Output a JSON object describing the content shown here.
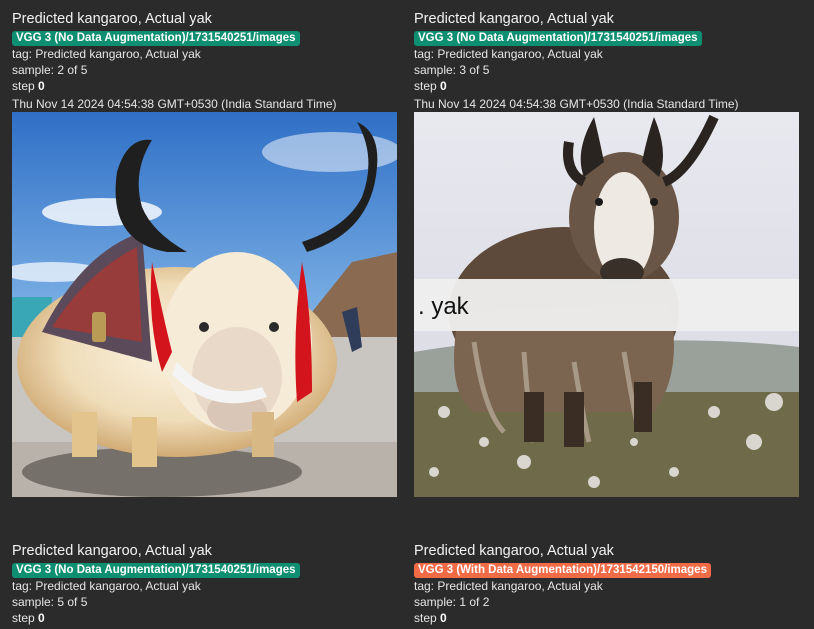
{
  "colors": {
    "badge_no_aug": "#0f8f72",
    "badge_with_aug": "#f26b47",
    "background": "#2b2b2b"
  },
  "cards": [
    {
      "title": "Predicted kangaroo, Actual yak",
      "run": "VGG 3 (No Data Augmentation)/1731540251/images",
      "tag": "tag: Predicted kangaroo, Actual yak",
      "sample": "sample: 2 of 5",
      "step_label": "step",
      "step_value": "0",
      "timestamp": "Thu Nov 14 2024 04:54:38 GMT+0530 (India Standard Time)"
    },
    {
      "title": "Predicted kangaroo, Actual yak",
      "run": "VGG 3 (No Data Augmentation)/1731540251/images",
      "tag": "tag: Predicted kangaroo, Actual yak",
      "sample": "sample: 3 of 5",
      "step_label": "step",
      "step_value": "0",
      "timestamp": "Thu Nov 14 2024 04:54:38 GMT+0530 (India Standard Time)",
      "image_caption": ". yak"
    },
    {
      "title": "Predicted kangaroo, Actual yak",
      "run": "VGG 3 (No Data Augmentation)/1731540251/images",
      "tag": "tag: Predicted kangaroo, Actual yak",
      "sample": "sample: 5 of 5",
      "step_label": "step",
      "step_value": "0"
    },
    {
      "title": "Predicted kangaroo, Actual yak",
      "run": "VGG 3 (With Data Augmentation)/1731542150/images",
      "tag": "tag: Predicted kangaroo, Actual yak",
      "sample": "sample: 1 of 2",
      "step_label": "step",
      "step_value": "0"
    }
  ]
}
